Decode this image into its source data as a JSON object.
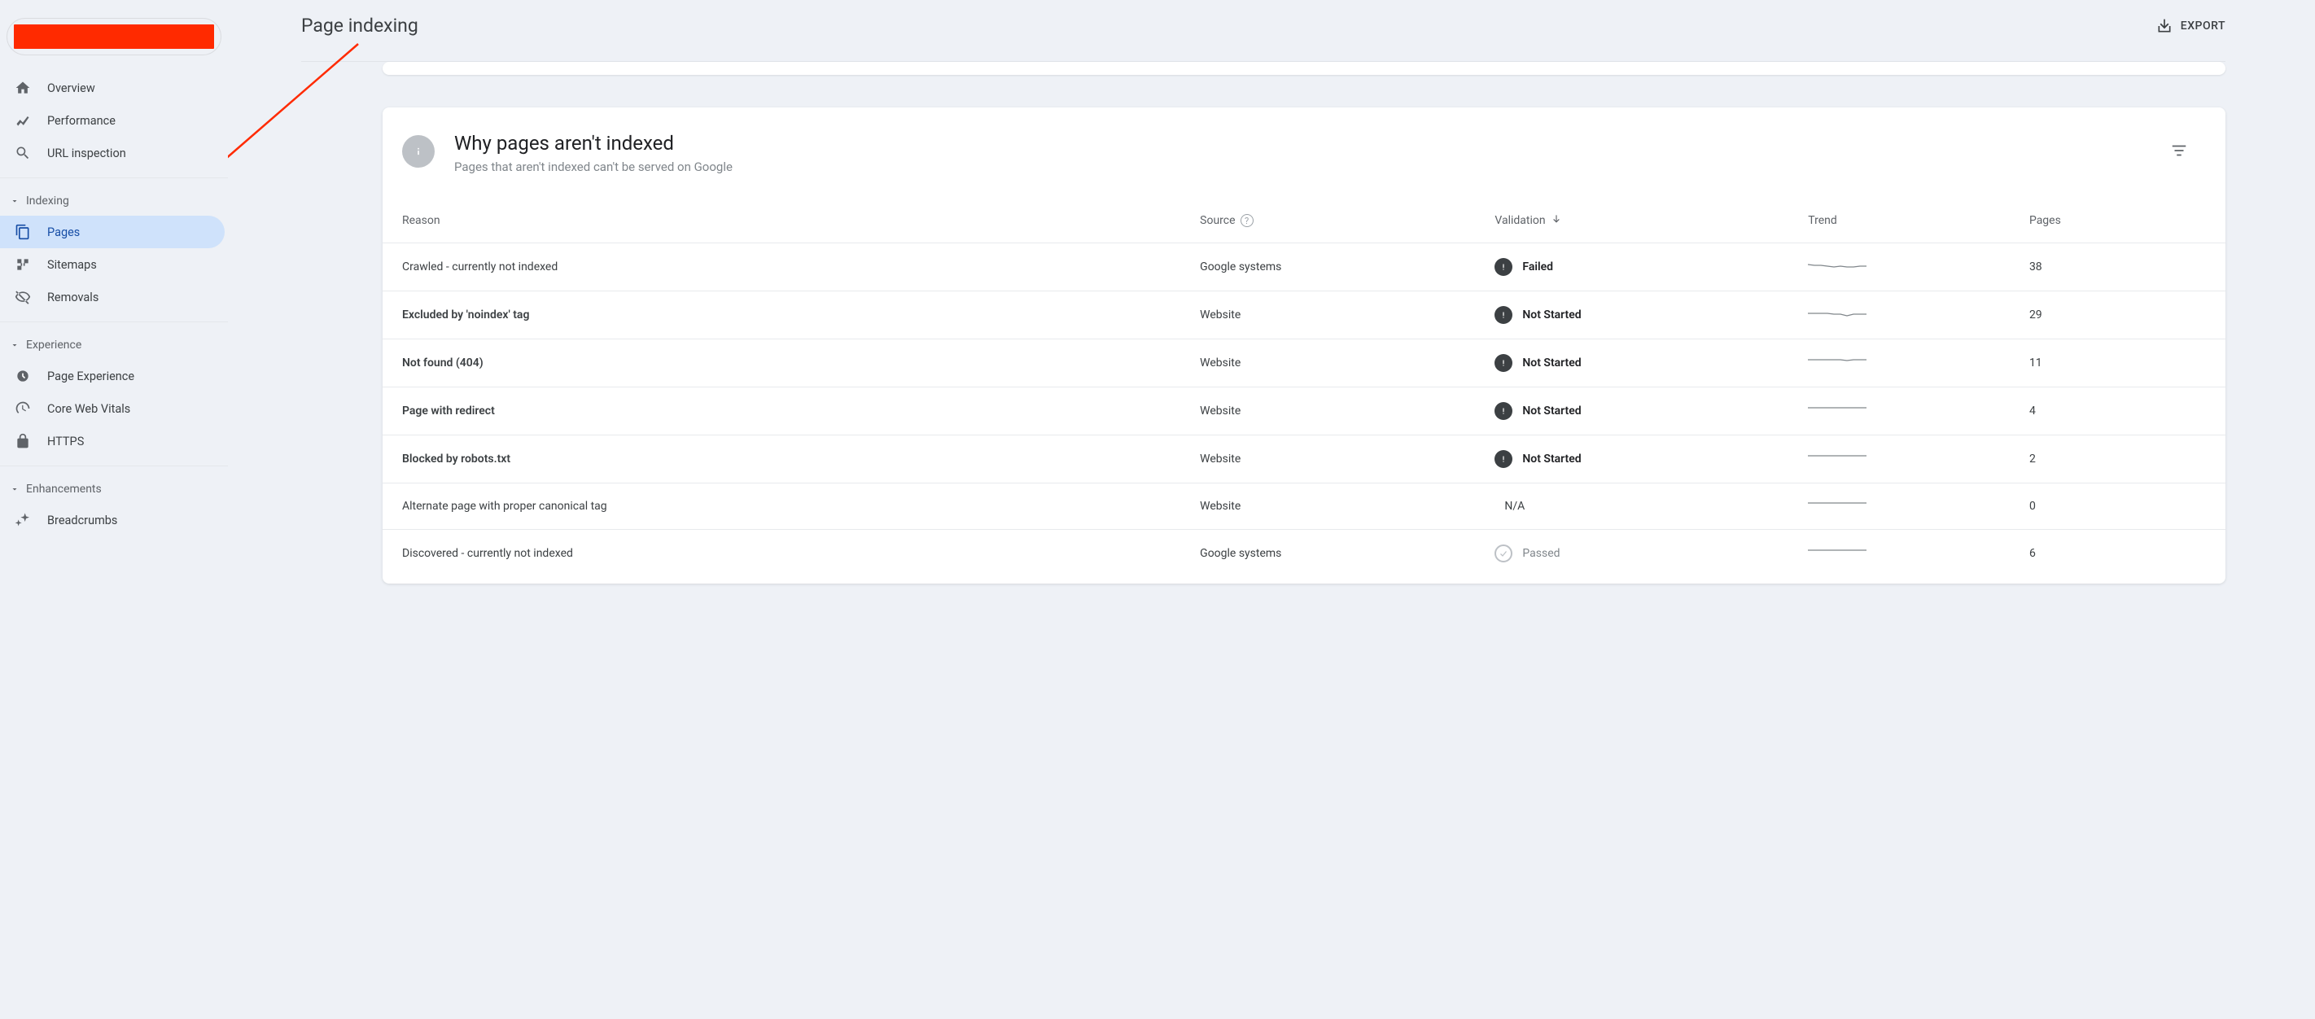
{
  "header": {
    "title": "Page indexing",
    "export_label": "EXPORT"
  },
  "sidebar": {
    "items_top": [
      {
        "label": "Overview",
        "icon": "home"
      },
      {
        "label": "Performance",
        "icon": "trend"
      },
      {
        "label": "URL inspection",
        "icon": "search"
      }
    ],
    "section_indexing": {
      "label": "Indexing",
      "items": [
        {
          "label": "Pages",
          "icon": "pages",
          "active": true
        },
        {
          "label": "Sitemaps",
          "icon": "sitemaps"
        },
        {
          "label": "Removals",
          "icon": "removals"
        }
      ]
    },
    "section_experience": {
      "label": "Experience",
      "items": [
        {
          "label": "Page Experience",
          "icon": "pageexp"
        },
        {
          "label": "Core Web Vitals",
          "icon": "cwv"
        },
        {
          "label": "HTTPS",
          "icon": "lock"
        }
      ]
    },
    "section_enhancements": {
      "label": "Enhancements",
      "items": [
        {
          "label": "Breadcrumbs",
          "icon": "breadcrumbs"
        }
      ]
    }
  },
  "card": {
    "title": "Why pages aren't indexed",
    "subtitle": "Pages that aren't indexed can't be served on Google",
    "columns": {
      "reason": "Reason",
      "source": "Source",
      "validation": "Validation",
      "trend": "Trend",
      "pages": "Pages"
    },
    "rows": [
      {
        "reason": "Crawled - currently not indexed",
        "bold": false,
        "source": "Google systems",
        "validation_status": "Failed",
        "validation_type": "failed",
        "pages": "38",
        "spark": [
          9,
          8,
          8,
          7,
          6,
          7,
          6,
          6,
          7,
          7
        ]
      },
      {
        "reason": "Excluded by 'noindex' tag",
        "bold": true,
        "source": "Website",
        "validation_status": "Not Started",
        "validation_type": "notstarted",
        "pages": "29",
        "spark": [
          8,
          8,
          8,
          8,
          7,
          7,
          5,
          7,
          7,
          7
        ]
      },
      {
        "reason": "Not found (404)",
        "bold": true,
        "source": "Website",
        "validation_status": "Not Started",
        "validation_type": "notstarted",
        "pages": "11",
        "spark": [
          10,
          10,
          10,
          10,
          10,
          10,
          9,
          10,
          10,
          10
        ]
      },
      {
        "reason": "Page with redirect",
        "bold": true,
        "source": "Website",
        "validation_status": "Not Started",
        "validation_type": "notstarted",
        "pages": "4",
        "spark": [
          10,
          10,
          10,
          10,
          10,
          10,
          10,
          10,
          10,
          10
        ]
      },
      {
        "reason": "Blocked by robots.txt",
        "bold": true,
        "source": "Website",
        "validation_status": "Not Started",
        "validation_type": "notstarted",
        "pages": "2",
        "spark": [
          10,
          10,
          10,
          10,
          10,
          10,
          10,
          10,
          10,
          10
        ]
      },
      {
        "reason": "Alternate page with proper canonical tag",
        "bold": false,
        "source": "Website",
        "validation_status": "N/A",
        "validation_type": "na",
        "pages": "0",
        "spark": [
          10,
          10,
          10,
          10,
          10,
          10,
          10,
          10,
          10,
          10
        ]
      },
      {
        "reason": "Discovered - currently not indexed",
        "bold": false,
        "source": "Google systems",
        "validation_status": "Passed",
        "validation_type": "passed",
        "pages": "6",
        "spark": [
          10,
          10,
          10,
          10,
          10,
          10,
          10,
          10,
          10,
          10
        ]
      }
    ]
  }
}
